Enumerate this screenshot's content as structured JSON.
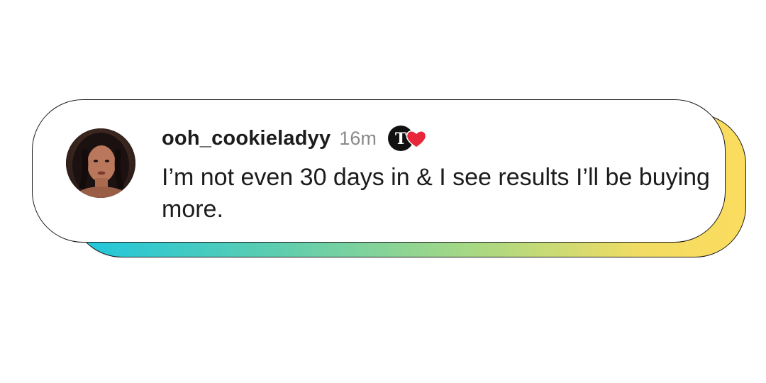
{
  "comment": {
    "username": "ooh_cookieladyy",
    "timestamp": "16m",
    "text": "I’m not even 30 days in & I see results I’ll be buying more.",
    "badge_letter": "T",
    "avatar_icon": "profile-photo",
    "liked_icon": "heart-icon"
  },
  "colors": {
    "shadow_gradient_start": "#1ec6de",
    "shadow_gradient_end": "#fbdc5e",
    "heart": "#e8263a",
    "username": "#1c1c1c",
    "timestamp": "#8a8a8a"
  }
}
